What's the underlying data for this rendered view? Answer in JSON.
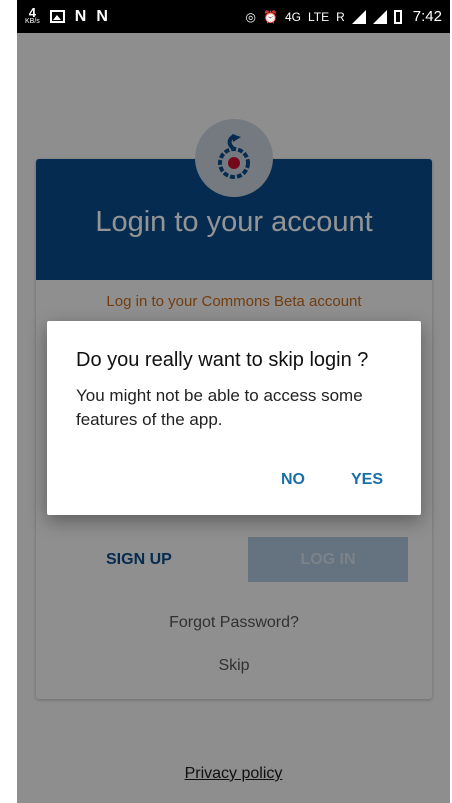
{
  "status_bar": {
    "kb_value": "4",
    "kb_unit": "KB/s",
    "app_glyph_1": "N",
    "app_glyph_2": "N",
    "network_4g": "4G",
    "network_lte": "LTE",
    "roaming": "R",
    "time": "7:42"
  },
  "card": {
    "title": "Login to your account",
    "subtitle": "Log in to your Commons Beta account",
    "signup_label": "SIGN UP",
    "login_label": "LOG IN",
    "forgot_label": "Forgot Password?",
    "skip_label": "Skip"
  },
  "footer": {
    "privacy_label": "Privacy policy"
  },
  "dialog": {
    "title": "Do you really want to skip login ?",
    "message": "You might not be able to access some features of the app.",
    "no_label": "NO",
    "yes_label": "YES"
  },
  "colors": {
    "header_blue": "#0a4c8a",
    "subtitle_orange": "#c56a1a",
    "dialog_button": "#1b6fa8",
    "login_button_disabled": "#aec4db"
  },
  "icons": {
    "logo": "commons-logo-icon"
  }
}
